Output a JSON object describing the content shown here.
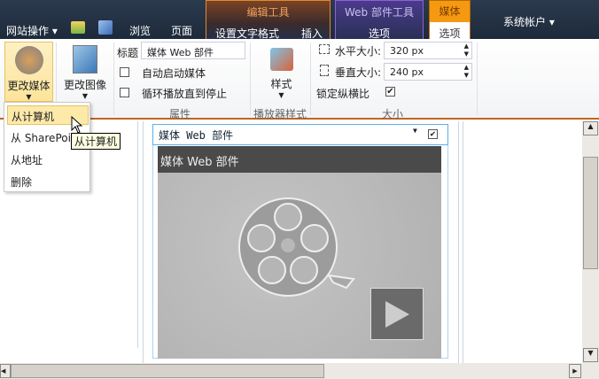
{
  "topnav": {
    "site_actions": "网站操作",
    "browse": "浏览",
    "page": "页面",
    "user": "系统帐户"
  },
  "context_groups": {
    "edit_tools": {
      "title": "编辑工具",
      "tabs": [
        "设置文字格式",
        "插入"
      ]
    },
    "webpart_tools": {
      "title": "Web 部件工具",
      "tabs": [
        "选项"
      ]
    },
    "media": {
      "title": "媒体",
      "tabs": [
        "选项"
      ]
    }
  },
  "ribbon": {
    "change_media": "更改媒体",
    "change_image": "更改图像",
    "title_label": "标题",
    "title_value": "媒体 Web 部件",
    "autostart": "自动启动媒体",
    "autostart_checked": false,
    "loop": "循环播放直到停止",
    "loop_checked": false,
    "styles": "样式",
    "hsize_label": "水平大小:",
    "hsize_value": "320 px",
    "vsize_label": "垂直大小:",
    "vsize_value": "240 px",
    "lock_ratio": "锁定纵横比",
    "lock_ratio_checked": true,
    "groups": [
      "属性",
      "播放器样式",
      "大小"
    ]
  },
  "menu": {
    "items": [
      "从计算机",
      "从 SharePoint",
      "从地址",
      "删除"
    ],
    "tooltip": "从计算机"
  },
  "webpart": {
    "header": "媒体 Web 部件",
    "title_bar": "媒体 Web 部件"
  },
  "colors": {
    "accent": "#f59a10",
    "ribbon_border": "#c3661f"
  }
}
